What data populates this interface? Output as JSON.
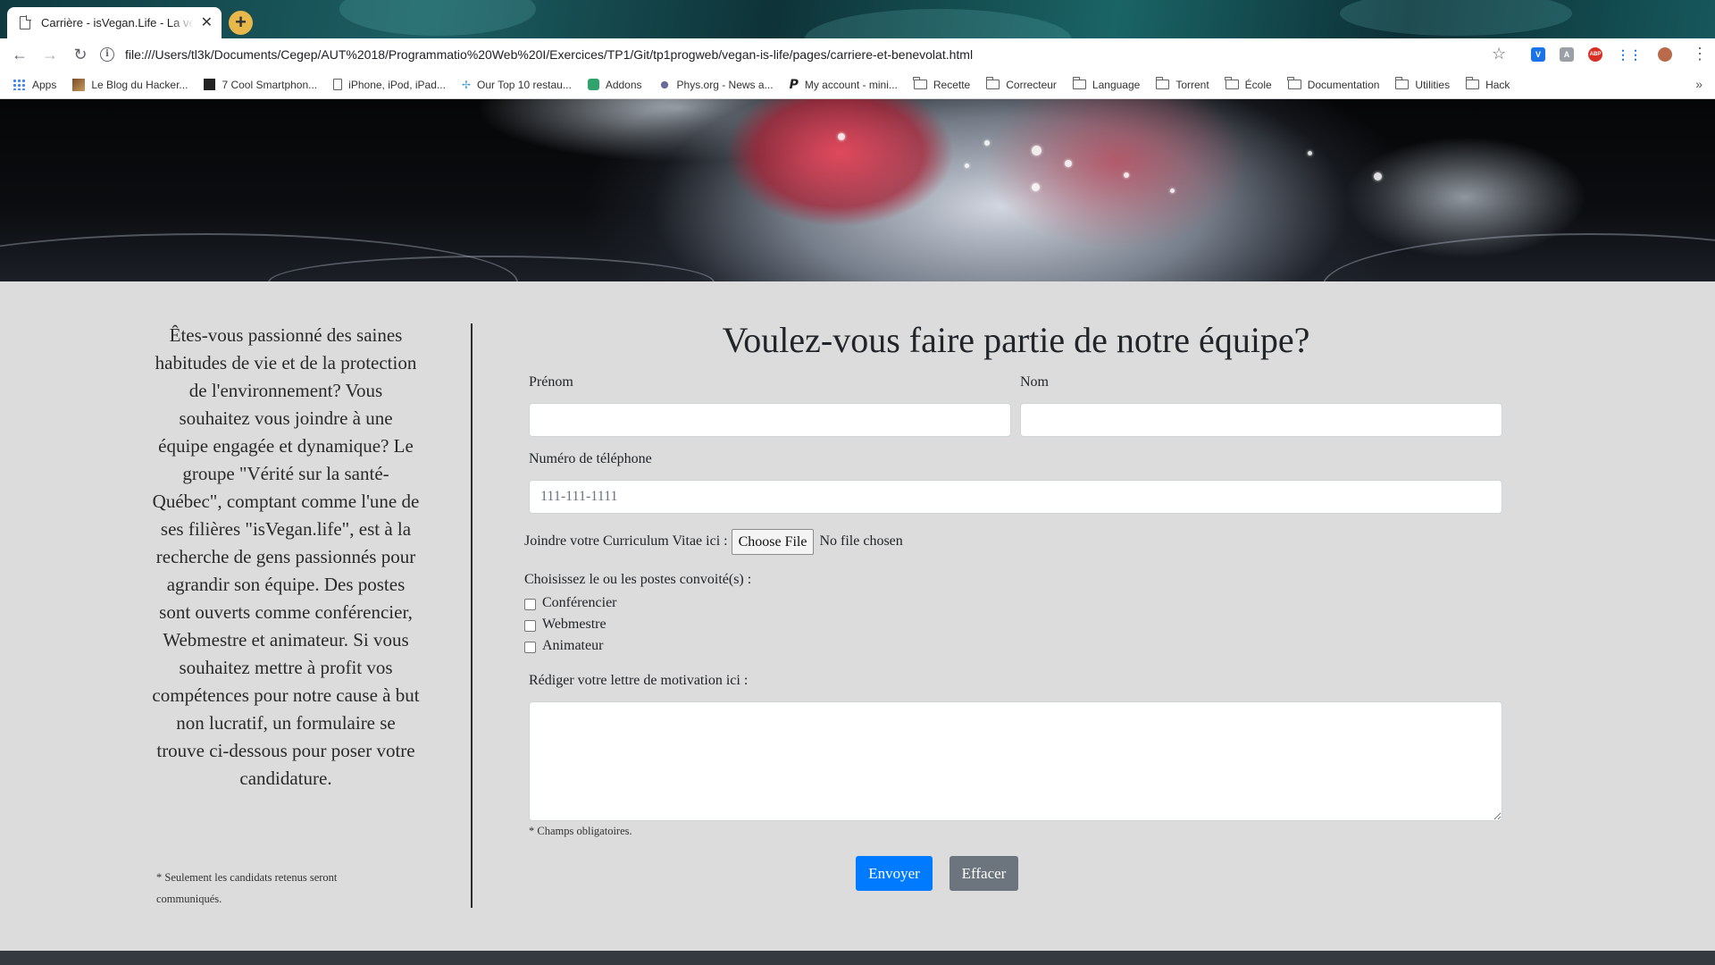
{
  "browser": {
    "tab_title": "Carrière - isVegan.Life - La vérité",
    "url": "file:///Users/tl3k/Documents/Cegep/AUT%2018/Programmatio%20Web%20I/Exercices/TP1/Git/tp1progweb/vegan-is-life/pages/carriere-et-benevolat.html",
    "bookmarks": [
      {
        "label": "Apps",
        "icon": "apps-grid-icon"
      },
      {
        "label": "Le Blog du Hacker...",
        "icon": "site-favicon-icon"
      },
      {
        "label": "7 Cool Smartphon...",
        "icon": "site-favicon-icon"
      },
      {
        "label": "iPhone, iPod, iPad...",
        "icon": "page-icon"
      },
      {
        "label": "Our Top 10 restau...",
        "icon": "site-favicon-icon"
      },
      {
        "label": "Addons",
        "icon": "puzzle-icon"
      },
      {
        "label": "Phys.org - News a...",
        "icon": "site-favicon-icon"
      },
      {
        "label": "My account - mini...",
        "icon": "paypal-icon"
      },
      {
        "label": "Recette",
        "icon": "folder-icon"
      },
      {
        "label": "Correcteur",
        "icon": "folder-icon"
      },
      {
        "label": "Language",
        "icon": "folder-icon"
      },
      {
        "label": "Torrent",
        "icon": "folder-icon"
      },
      {
        "label": "École",
        "icon": "folder-icon"
      },
      {
        "label": "Documentation",
        "icon": "folder-icon"
      },
      {
        "label": "Utilities",
        "icon": "folder-icon"
      },
      {
        "label": "Hack",
        "icon": "folder-icon"
      }
    ],
    "more": "»",
    "ext_abp": "ABP"
  },
  "sidebar": {
    "text": "Êtes-vous passionné des saines habitudes de vie et de la protection de l'environnement? Vous souhaitez vous joindre à une équipe engagée et dynamique? Le groupe \"Vérité sur la santé-Québec\", comptant comme l'une de ses filières \"isVegan.life\", est à la recherche de gens passionnés pour agrandir son équipe. Des postes sont ouverts comme conférencier, Webmestre et animateur. Si vous souhaitez mettre à profit vos compétences pour notre cause à but non lucratif, un formulaire se trouve ci-dessous pour poser votre candidature.",
    "note": "* Seulement les candidats retenus seront communiqués."
  },
  "form": {
    "title": "Voulez-vous faire partie de notre équipe?",
    "first_name_label": "Prénom",
    "first_name_value": "",
    "last_name_label": "Nom",
    "last_name_value": "",
    "phone_label": "Numéro de téléphone",
    "phone_placeholder": "111-111-1111",
    "cv_label": "Joindre votre Curriculum Vitae ici :",
    "cv_button": "Choose File",
    "cv_status": "No file chosen",
    "positions_label": "Choisissez le ou les postes convoité(s) :",
    "positions": [
      {
        "label": "Conférencier",
        "checked": false
      },
      {
        "label": "Webmestre",
        "checked": false
      },
      {
        "label": "Animateur",
        "checked": false
      }
    ],
    "letter_label": "Rédiger votre lettre de motivation ici :",
    "letter_value": "",
    "required_note": "* Champs obligatoires.",
    "submit_label": "Envoyer",
    "reset_label": "Effacer"
  },
  "colors": {
    "primary": "#007bff",
    "secondary": "#6c757d",
    "page_bg": "#dcdcdc",
    "footer": "#343a40"
  }
}
